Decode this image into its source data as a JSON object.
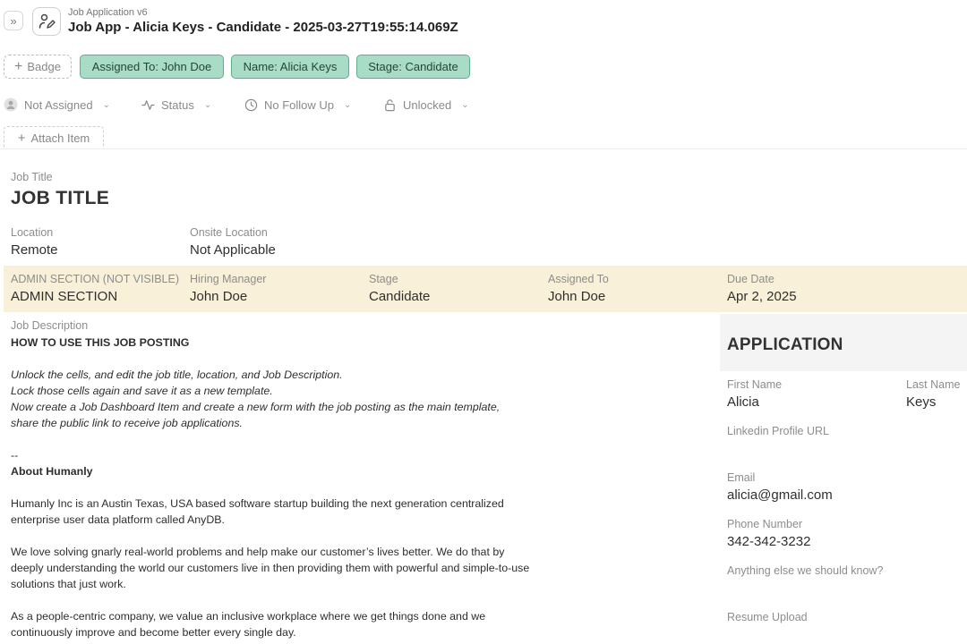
{
  "header": {
    "expand_icon": "chevrons-right-icon",
    "type_icon": "person-edit-icon",
    "subtitle": "Job Application v6",
    "title": "Job App - Alicia Keys - Candidate - 2025-03-27T19:55:14.069Z"
  },
  "badges": {
    "add_label": "Badge",
    "items": [
      "Assigned To: John Doe",
      "Name: Alicia Keys",
      "Stage: Candidate"
    ],
    "color": "#a8dcc6",
    "border_color": "#5fae8c"
  },
  "properties": {
    "assignee": "Not Assigned",
    "status": "Status",
    "follow_up": "No Follow Up",
    "lock": "Unlocked"
  },
  "attach_label": "Attach Item",
  "job": {
    "title_label": "Job Title",
    "title_value": "JOB TITLE",
    "location_label": "Location",
    "location_value": "Remote",
    "onsite_label": "Onsite Location",
    "onsite_value": "Not Applicable"
  },
  "admin": {
    "section_label": "ADMIN SECTION (NOT VISIBLE)",
    "section_value": "ADMIN SECTION",
    "manager_label": "Hiring Manager",
    "manager_value": "John Doe",
    "stage_label": "Stage",
    "stage_value": "Candidate",
    "assigned_label": "Assigned To",
    "assigned_value": "John Doe",
    "due_label": "Due Date",
    "due_value": "Apr 2, 2025",
    "band_color": "#f8f0d8"
  },
  "description": {
    "label": "Job Description",
    "heading": "HOW TO USE THIS JOB POSTING",
    "instructions": [
      "Unlock the cells, and edit the job title, location, and Job Description.",
      "Lock those cells again and save it as a new template.",
      "Now create a Job Dashboard Item and create a new form with the job posting as the main template,",
      "share the public link to receive job applications."
    ],
    "separator": "--",
    "about_heading": "About Humanly",
    "para1": "Humanly Inc is an Austin Texas, USA based software startup building the next generation centralized enterprise user data platform called AnyDB.",
    "para2": "We love solving gnarly real-world problems and help make our customer’s lives better. We do that by deeply understanding the world our customers live in then providing them with powerful and simple-to-use solutions that just work.",
    "para3": "As a people-centric company, we value an inclusive workplace where we get things done and we continuously improve and become better every single day."
  },
  "application": {
    "title": "APPLICATION",
    "first_name_label": "First Name",
    "first_name_value": "Alicia",
    "last_name_label": "Last Name",
    "last_name_value": "Keys",
    "linkedin_label": "Linkedin Profile URL",
    "email_label": "Email",
    "email_value": "alicia@gmail.com",
    "phone_label": "Phone Number",
    "phone_value": "342-342-3232",
    "notes_label": "Anything else we should know?",
    "resume_label": "Resume Upload"
  }
}
